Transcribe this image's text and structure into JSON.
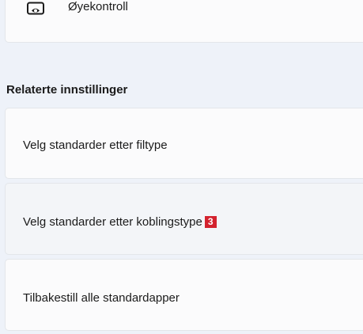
{
  "top_item": {
    "icon": "eye-control-icon",
    "label": "Øyekontroll"
  },
  "related": {
    "heading": "Relaterte innstillinger",
    "items": [
      {
        "label": "Velg standarder etter filtype"
      },
      {
        "label": "Velg standarder etter koblingstype",
        "badge": "3"
      },
      {
        "label": "Tilbakestill alle standardapper"
      }
    ]
  },
  "colors": {
    "background": "#eef2f9",
    "card": "#fbfbfc",
    "card_hover": "#f3f5f8",
    "badge": "#d3222e"
  }
}
